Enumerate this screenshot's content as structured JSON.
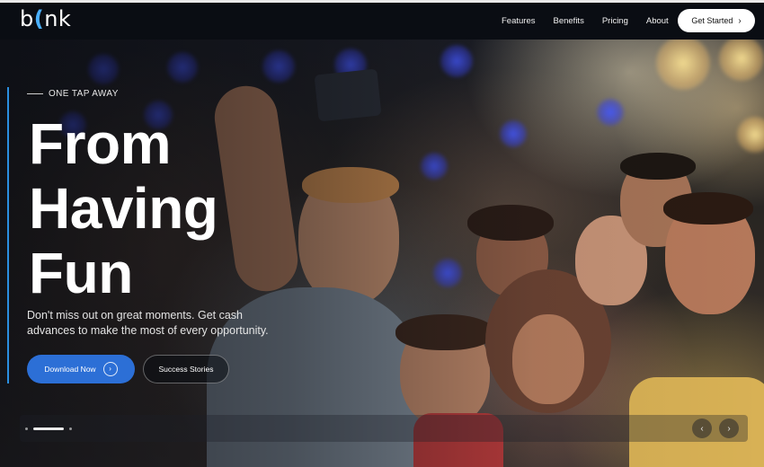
{
  "brand": {
    "logo_text_left": "b",
    "logo_wave": "(",
    "logo_text_right": "nk"
  },
  "nav": {
    "items": [
      {
        "label": "Features"
      },
      {
        "label": "Benefits"
      },
      {
        "label": "Pricing"
      },
      {
        "label": "About"
      }
    ],
    "cta_label": "Get Started",
    "cta_icon": "chevron-right-icon"
  },
  "hero": {
    "eyebrow": "ONE TAP AWAY",
    "headline": [
      "From",
      "Having",
      "Fun"
    ],
    "subtitle": "Don't miss out on great moments. Get cash advances to make the most of every opportunity.",
    "primary_button": {
      "label": "Download Now",
      "icon": "arrow-right-icon"
    },
    "secondary_button": {
      "label": "Success Stories"
    }
  },
  "slider": {
    "slide_count": 3,
    "active_index": 0,
    "prev_icon": "chevron-left-icon",
    "next_icon": "chevron-right-icon"
  },
  "colors": {
    "accent_blue": "#2c6fd6",
    "accent_bar": "#2a8fe0",
    "logo_wave": "#4ab0ff",
    "nav_background": "#0a0d13"
  }
}
